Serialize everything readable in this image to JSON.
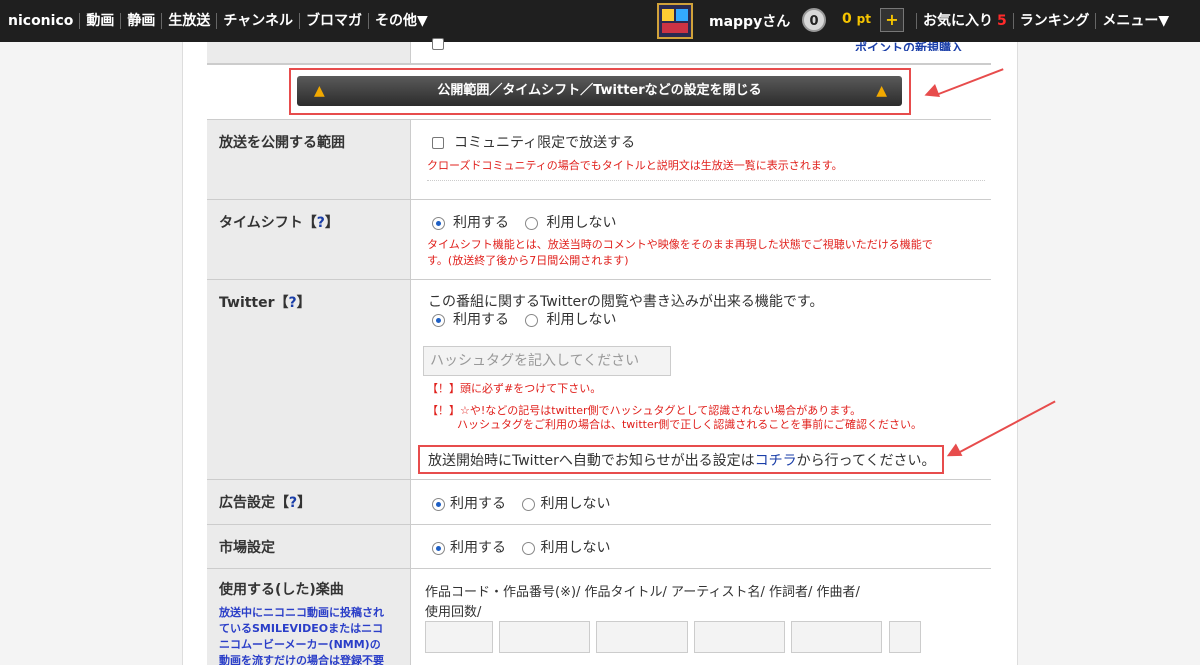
{
  "topbar": {
    "nav": [
      "niconico",
      "動画",
      "静画",
      "生放送",
      "チャンネル",
      "ブロマガ",
      "その他▼"
    ],
    "username": "mappyさん",
    "notification_count": "0",
    "points_value": "0",
    "points_unit": "pt",
    "plus_label": "+",
    "favorites_label": "お気に入り",
    "favorites_count": "5",
    "ranking_label": "ランキング",
    "menu_label": "メニュー▼"
  },
  "top_partial": {
    "link_text": "ポイントの新規購入"
  },
  "close_bar": {
    "label": "公開範囲／タイムシフト／Twitterなどの設定を閉じる"
  },
  "rows": {
    "scope": {
      "label": "放送を公開する範囲",
      "checkbox_label": "コミュニティ限定で放送する",
      "note": "クローズドコミュニティの場合でもタイトルと説明文は生放送一覧に表示されます。"
    },
    "timeshift": {
      "label": "タイムシフト【",
      "help": "?",
      "label_end": "】",
      "opt_use": "利用する",
      "opt_nouse": "利用しない",
      "note1": "タイムシフト機能とは、放送当時のコメントや映像をそのまま再現した状態でご視聴いただける機能で",
      "note2": "す。(放送終了後から7日間公開されます)"
    },
    "twitter": {
      "label": "Twitter【",
      "help": "?",
      "label_end": "】",
      "desc": "この番組に関するTwitterの閲覧や書き込みが出来る機能です。",
      "opt_use": "利用する",
      "opt_nouse": "利用しない",
      "hashtag_placeholder": "ハッシュタグを記入してください",
      "warn1": "【！】頭に必ず#をつけて下さい。",
      "warn2": "【！】☆や!などの記号はtwitter側でハッシュタグとして認識されない場合があります。",
      "warn3": "ハッシュタグをご利用の場合は、twitter側で正しく認識されることを事前にご確認ください。",
      "notice_pre": "放送開始時にTwitterへ自動でお知らせが出る設定は",
      "notice_link": "コチラ",
      "notice_post": "から行ってください。"
    },
    "ads": {
      "label": "広告設定【",
      "help": "?",
      "label_end": "】",
      "opt_use": "利用する",
      "opt_nouse": "利用しない"
    },
    "market": {
      "label": "市場設定",
      "opt_use": "利用する",
      "opt_nouse": "利用しない"
    },
    "music": {
      "label": "使用する(した)楽曲",
      "sub1": "放送中にニコニコ動画に投稿され",
      "sub2": "ているSMILEVIDEOまたはニコ",
      "sub3": "ニコムービーメーカー(NMM)の",
      "sub4": "動画を流すだけの場合は登録不要",
      "header1": "作品コード・作品番号(※)/  作品タイトル/  アーティスト名/  作詞者/  作曲者/",
      "header2": "使用回数/"
    }
  }
}
